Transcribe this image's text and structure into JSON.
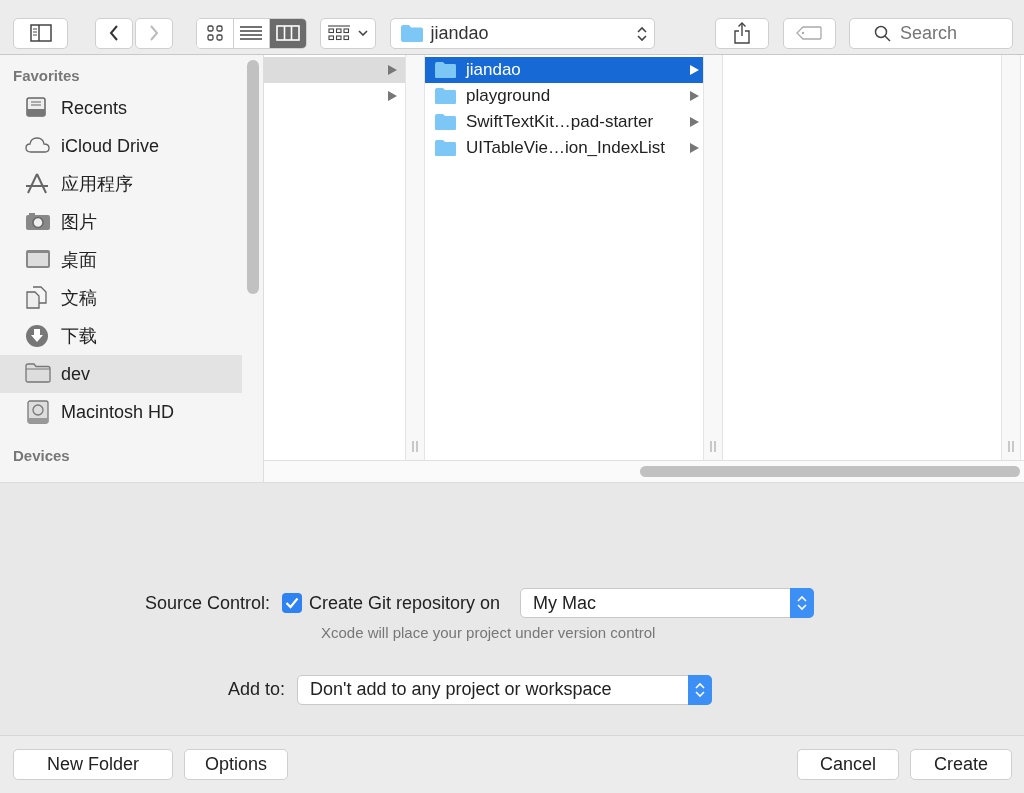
{
  "toolbar": {
    "view_modes": [
      {
        "kind": "icons",
        "selected": false
      },
      {
        "kind": "list",
        "selected": false
      },
      {
        "kind": "columns",
        "selected": true
      }
    ],
    "path_popup": "jiandao",
    "search": {
      "placeholder": "Search"
    }
  },
  "sidebar": {
    "sections": [
      {
        "title": "Favorites",
        "items": [
          {
            "label": "Recents",
            "kind": "recents",
            "selected": false
          },
          {
            "label": "iCloud Drive",
            "kind": "cloud",
            "selected": false
          },
          {
            "label": "应用程序",
            "kind": "apps",
            "selected": false
          },
          {
            "label": "图片",
            "kind": "camera",
            "selected": false
          },
          {
            "label": "桌面",
            "kind": "desktop",
            "selected": false
          },
          {
            "label": "文稿",
            "kind": "documents",
            "selected": false
          },
          {
            "label": "下载",
            "kind": "download",
            "selected": false
          },
          {
            "label": "dev",
            "kind": "folder",
            "selected": true
          },
          {
            "label": "Macintosh HD",
            "kind": "disk",
            "selected": false
          }
        ]
      },
      {
        "title": "Devices"
      }
    ]
  },
  "browser": {
    "column_1": {
      "rows": [
        {
          "selected": true
        },
        {
          "selected": false
        }
      ]
    },
    "column_2": {
      "rows": [
        {
          "label": "jiandao",
          "selected": true
        },
        {
          "label": "playground",
          "selected": false
        },
        {
          "label": "SwiftTextKit…pad-starter",
          "selected": false
        },
        {
          "label": "UITableVie…ion_IndexList",
          "selected": false
        }
      ]
    }
  },
  "source_control": {
    "label": "Source Control:",
    "checkbox": {
      "label": "Create Git repository on",
      "checked": true
    },
    "popup": "My Mac",
    "hint": "Xcode will place your project under version control"
  },
  "add_to": {
    "label": "Add to:",
    "popup": "Don't add to any project or workspace"
  },
  "footer": {
    "left_buttons": [
      "New Folder",
      "Options"
    ],
    "right_buttons": [
      "Cancel",
      "Create"
    ]
  }
}
